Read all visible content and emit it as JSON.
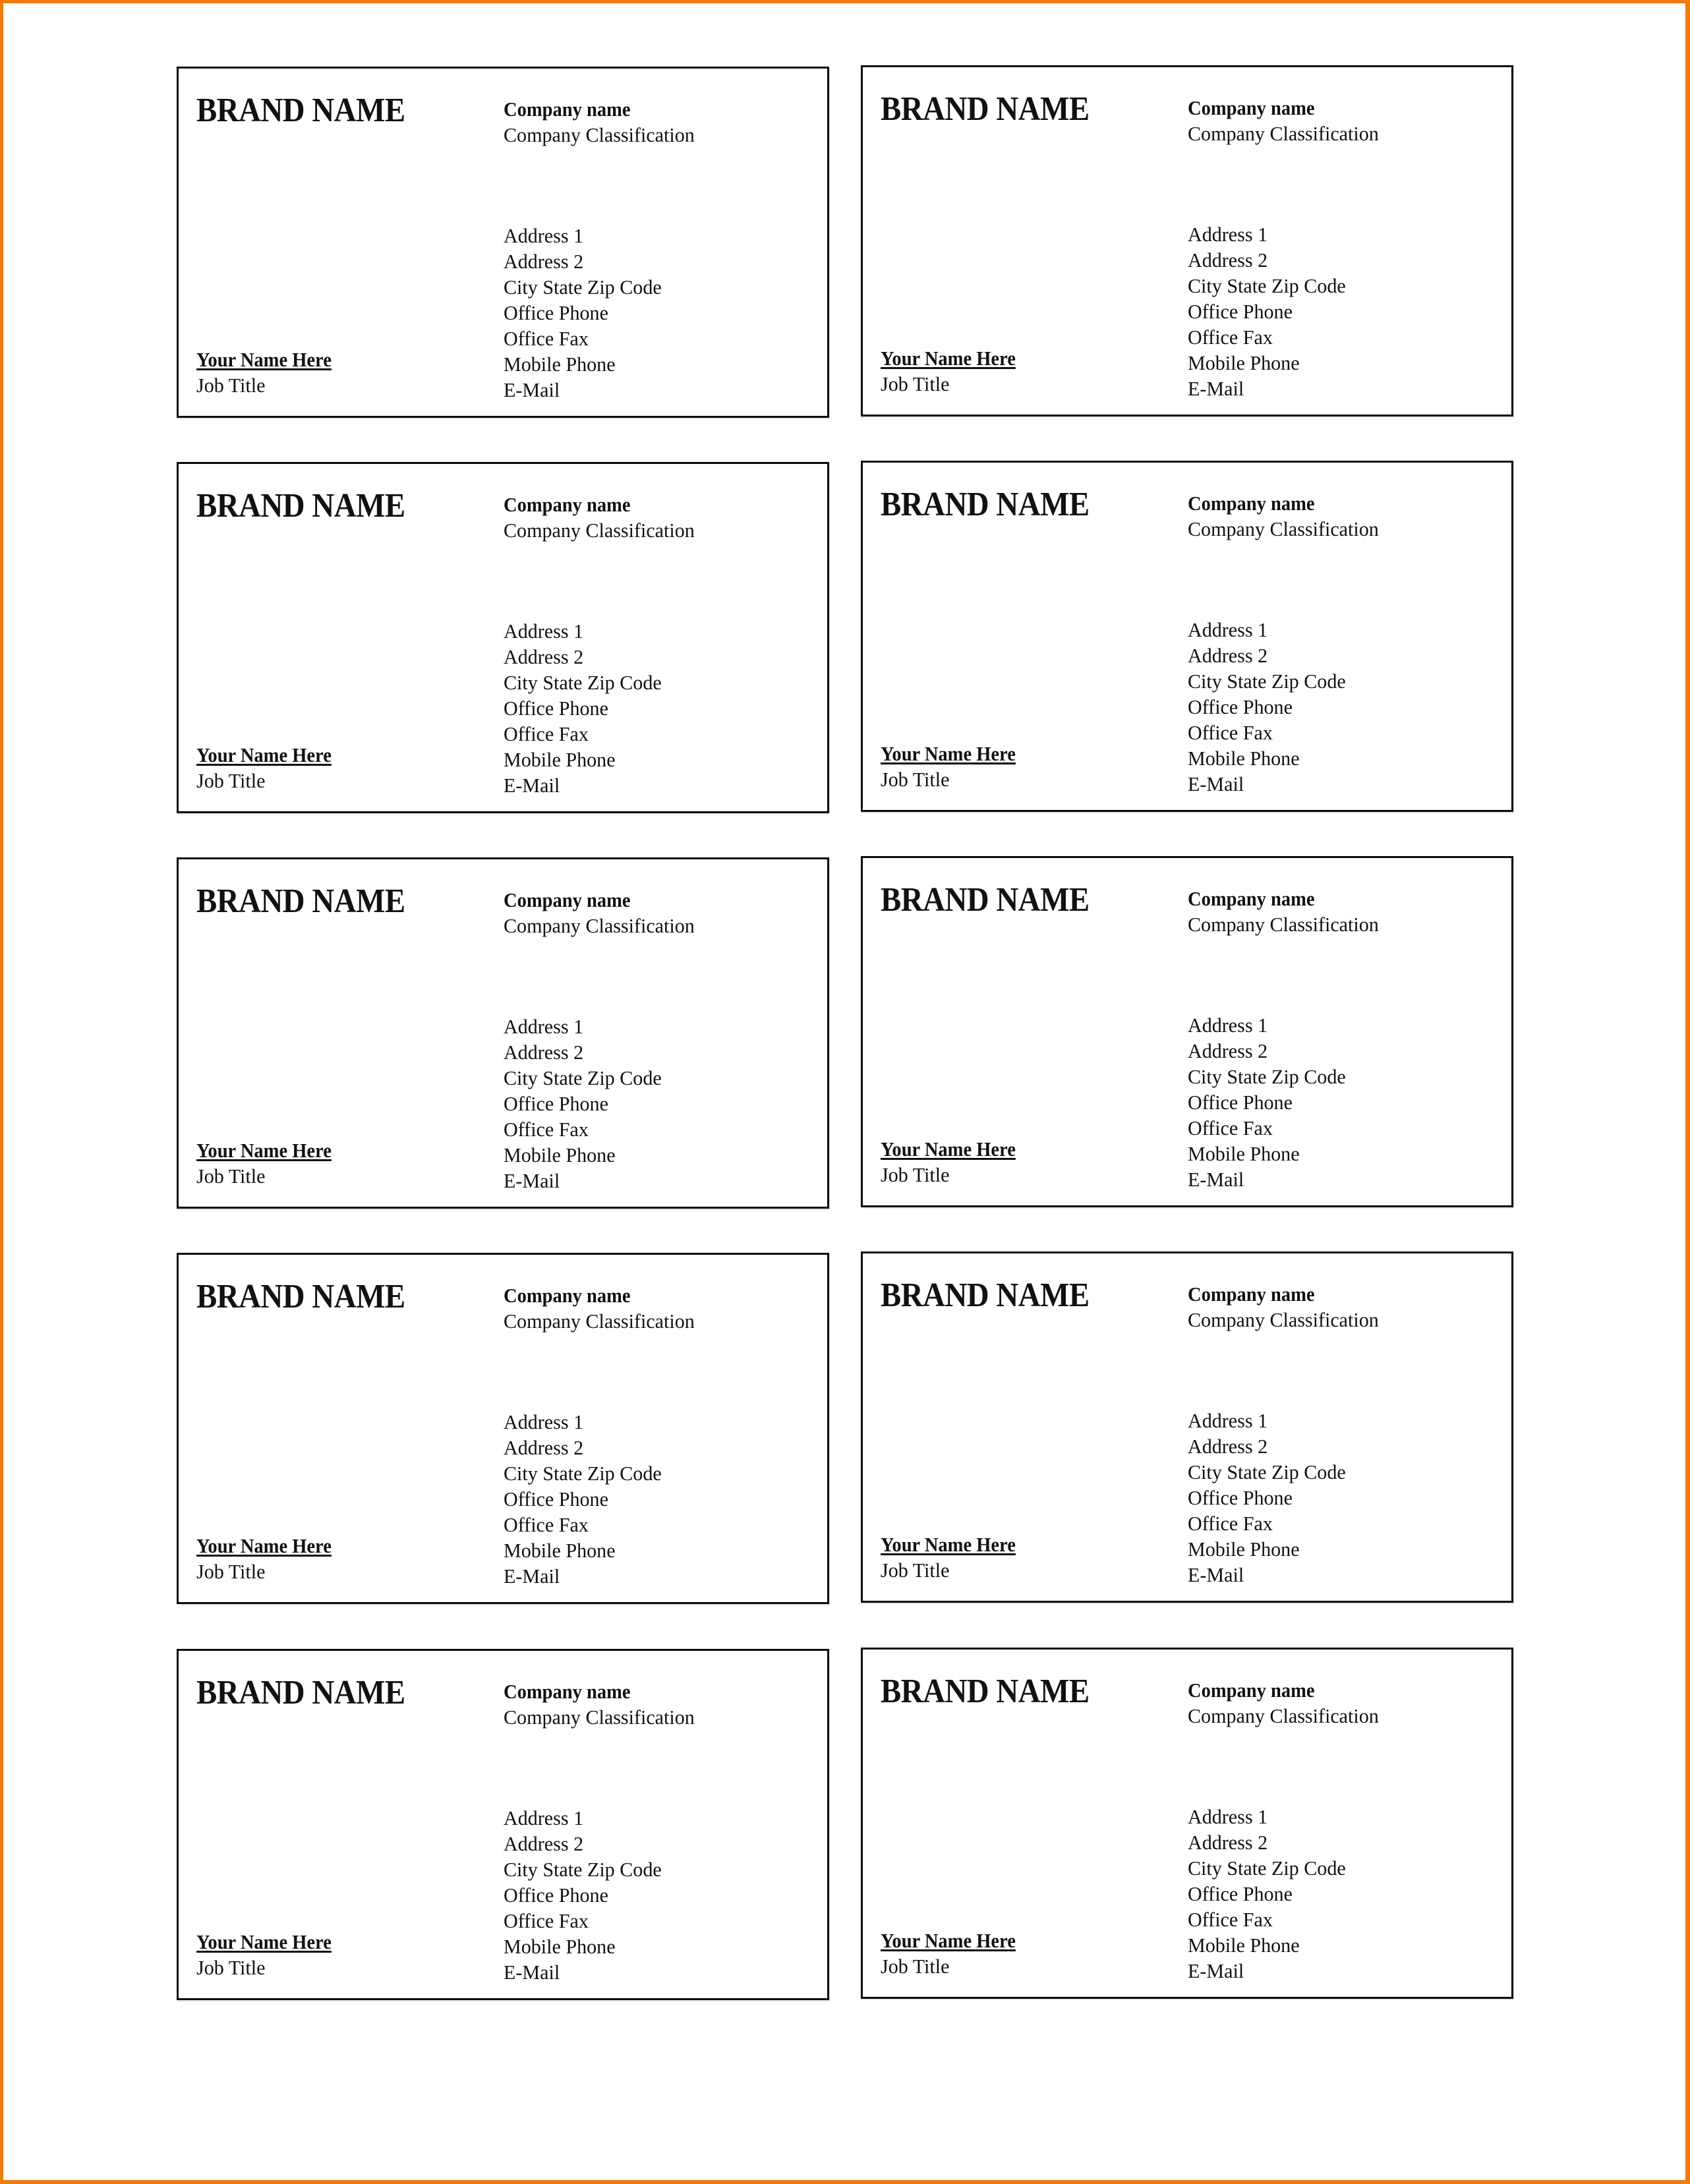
{
  "page": {
    "frame_color": "#f07c10",
    "layout": "business card sheet, 5 rows x 2 columns"
  },
  "cards": [
    {
      "brand": "BRAND NAME",
      "company_name": "Company name",
      "company_classification": "Company Classification",
      "contact_lines": [
        "Address 1",
        "Address 2",
        "City State Zip Code",
        "Office Phone",
        "Office Fax",
        "Mobile Phone",
        "E-Mail"
      ],
      "person_name": "Your Name Here",
      "job_title": "Job Title"
    },
    {
      "brand": "BRAND NAME",
      "company_name": "Company name",
      "company_classification": "Company Classification",
      "contact_lines": [
        "Address 1",
        "Address 2",
        "City State Zip Code",
        "Office Phone",
        "Office Fax",
        "Mobile Phone",
        "E-Mail"
      ],
      "person_name": "Your Name Here",
      "job_title": "Job Title"
    },
    {
      "brand": "BRAND NAME",
      "company_name": "Company name",
      "company_classification": "Company Classification",
      "contact_lines": [
        "Address 1",
        "Address 2",
        "City State Zip Code",
        "Office Phone",
        "Office Fax",
        "Mobile Phone",
        "E-Mail"
      ],
      "person_name": "Your Name Here",
      "job_title": "Job Title"
    },
    {
      "brand": "BRAND NAME",
      "company_name": "Company name",
      "company_classification": "Company Classification",
      "contact_lines": [
        "Address 1",
        "Address 2",
        "City State Zip Code",
        "Office Phone",
        "Office Fax",
        "Mobile Phone",
        "E-Mail"
      ],
      "person_name": "Your Name Here",
      "job_title": "Job Title"
    },
    {
      "brand": "BRAND NAME",
      "company_name": "Company name",
      "company_classification": "Company Classification",
      "contact_lines": [
        "Address 1",
        "Address 2",
        "City State Zip Code",
        "Office Phone",
        "Office Fax",
        "Mobile Phone",
        "E-Mail"
      ],
      "person_name": "Your Name Here",
      "job_title": "Job Title"
    },
    {
      "brand": "BRAND NAME",
      "company_name": "Company name",
      "company_classification": "Company Classification",
      "contact_lines": [
        "Address 1",
        "Address 2",
        "City State Zip Code",
        "Office Phone",
        "Office Fax",
        "Mobile Phone",
        "E-Mail"
      ],
      "person_name": "Your Name Here",
      "job_title": "Job Title"
    },
    {
      "brand": "BRAND NAME",
      "company_name": "Company name",
      "company_classification": "Company Classification",
      "contact_lines": [
        "Address 1",
        "Address 2",
        "City State Zip Code",
        "Office Phone",
        "Office Fax",
        "Mobile Phone",
        "E-Mail"
      ],
      "person_name": "Your Name Here",
      "job_title": "Job Title"
    },
    {
      "brand": "BRAND NAME",
      "company_name": "Company name",
      "company_classification": "Company Classification",
      "contact_lines": [
        "Address 1",
        "Address 2",
        "City State Zip Code",
        "Office Phone",
        "Office Fax",
        "Mobile Phone",
        "E-Mail"
      ],
      "person_name": "Your Name Here",
      "job_title": "Job Title"
    },
    {
      "brand": "BRAND NAME",
      "company_name": "Company name",
      "company_classification": "Company Classification",
      "contact_lines": [
        "Address 1",
        "Address 2",
        "City State Zip Code",
        "Office Phone",
        "Office Fax",
        "Mobile Phone",
        "E-Mail"
      ],
      "person_name": "Your Name Here",
      "job_title": "Job Title"
    },
    {
      "brand": "BRAND NAME",
      "company_name": "Company name",
      "company_classification": "Company Classification",
      "contact_lines": [
        "Address 1",
        "Address 2",
        "City State Zip Code",
        "Office Phone",
        "Office Fax",
        "Mobile Phone",
        "E-Mail"
      ],
      "person_name": "Your Name Here",
      "job_title": "Job Title"
    }
  ]
}
